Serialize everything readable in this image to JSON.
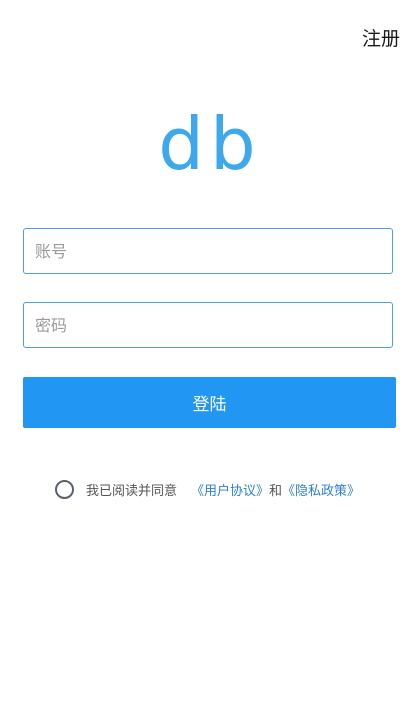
{
  "header": {
    "register_label": "注册"
  },
  "logo": {
    "text": "db"
  },
  "form": {
    "account_placeholder": "账号",
    "password_placeholder": "密码",
    "login_label": "登陆"
  },
  "agreement": {
    "text": "我已阅读并同意",
    "user_agreement_link": "《用户协议》",
    "and_text": "和",
    "privacy_policy_link": "《隐私政策》"
  },
  "colors": {
    "accent": "#2196f3",
    "logo": "#3ea8ec",
    "field_border": "#4f9fe0",
    "link": "#2f80d0"
  }
}
